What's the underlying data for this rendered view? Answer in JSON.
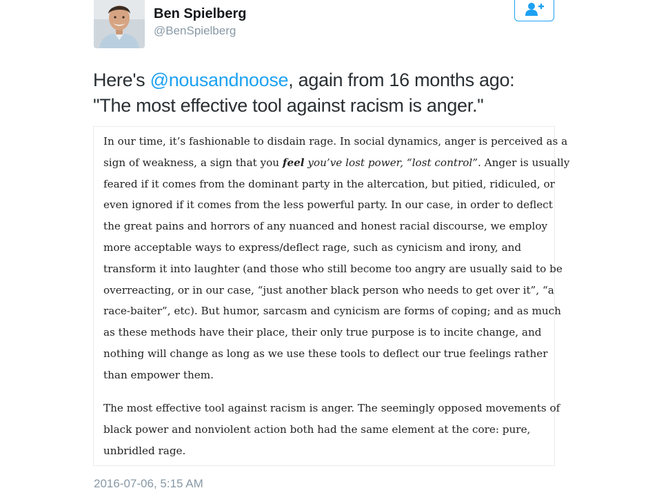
{
  "author": {
    "display_name": "Ben Spielberg",
    "handle": "@BenSpielberg"
  },
  "follow_button": {
    "icon": "add-user-icon",
    "color": "#1da1f2"
  },
  "tweet": {
    "line1": {
      "prefix": "Here's ",
      "mention": "@nousandnoose",
      "suffix": ", again from 16 months ago:"
    },
    "line2": "\"The most effective tool against racism is anger.\""
  },
  "quote": {
    "p1": {
      "l1": "In our time, it’s fashionable to disdain rage. In social dynamics, anger is perceived as a",
      "l2_a": "sign of weakness, a sign that you ",
      "l2_bold": "feel",
      "l2_italic": " you’ve lost power, “lost control”",
      "l2_b": ". Anger is usually",
      "l3": "feared if it comes from the dominant party in the altercation, but pitied, ridiculed, or",
      "l4": "even ignored if it comes from the less powerful party. In our case, in order to deflect",
      "l5": "the great pains and horrors of any nuanced and honest racial discourse, we employ",
      "l6": "more acceptable ways to express/deflect rage, such as cynicism and irony, and",
      "l7": "transform it into laughter (and those who still become too angry are usually said to be",
      "l8": "overreacting, or in our case, “just another black person who needs to get over it”, “a",
      "l9": "race-baiter”, etc). But humor, sarcasm and cynicism are forms of coping; and as much",
      "l10": "as these methods have their place, their only true purpose is to incite change, and",
      "l11": "nothing will change as long as we use these tools to deflect our true feelings rather",
      "l12": "than empower them."
    },
    "p2": {
      "l1": "The most effective tool against racism is anger. The seemingly opposed movements of",
      "l2": "black power and nonviolent action both had the same element at the core: pure,",
      "l3": "unbridled rage."
    }
  },
  "timestamp": "2016-07-06, 5:15 AM",
  "colors": {
    "link": "#1da1f2",
    "muted": "#8899a6",
    "text": "#292f33"
  }
}
